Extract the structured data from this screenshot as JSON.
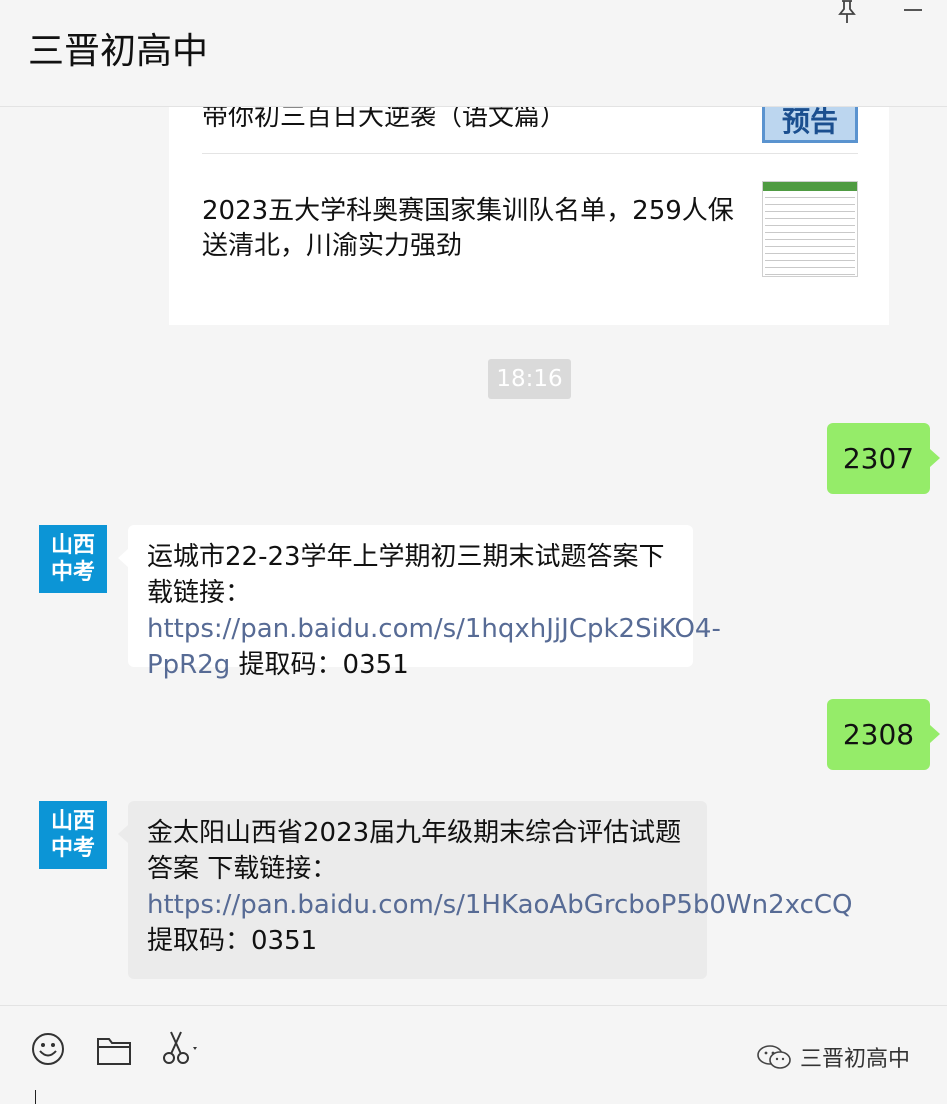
{
  "window": {
    "title": "三晋初高中"
  },
  "articles": [
    {
      "title": "带你初三百日大逆袭（语文篇）",
      "thumb_text": "预告"
    },
    {
      "title": "2023五大学科奥赛国家集训队名单，259人保送清北，川渝实力强劲"
    }
  ],
  "timestamp": "18:16",
  "messages": [
    {
      "direction": "out",
      "text": "2307"
    },
    {
      "direction": "in",
      "avatar": [
        "山西",
        "中考"
      ],
      "text_before": "运城市22-23学年上学期初三期末试题答案下载链接：",
      "link": "https://pan.baidu.com/s/1hqxhJjJCpk2SiKO4-PpR2g",
      "text_after": " 提取码：0351"
    },
    {
      "direction": "out",
      "text": "2308"
    },
    {
      "direction": "in",
      "avatar": [
        "山西",
        "中考"
      ],
      "text_before": "金太阳山西省2023届九年级期末综合评估试题答案 下载链接：",
      "link": "https://pan.baidu.com/s/1HKaoAbGrcboP5b0Wn2xcCQ",
      "text_after": " 提取码：0351"
    }
  ],
  "toolbar": {
    "icons": [
      "emoji-icon",
      "folder-icon",
      "scissors-icon"
    ]
  },
  "watermark": {
    "text": "三晋初高中"
  },
  "colors": {
    "outgoing_bubble": "#95ec69",
    "incoming_bubble": "#ffffff",
    "link": "#576b95",
    "avatar_bg": "#0c95d6"
  }
}
